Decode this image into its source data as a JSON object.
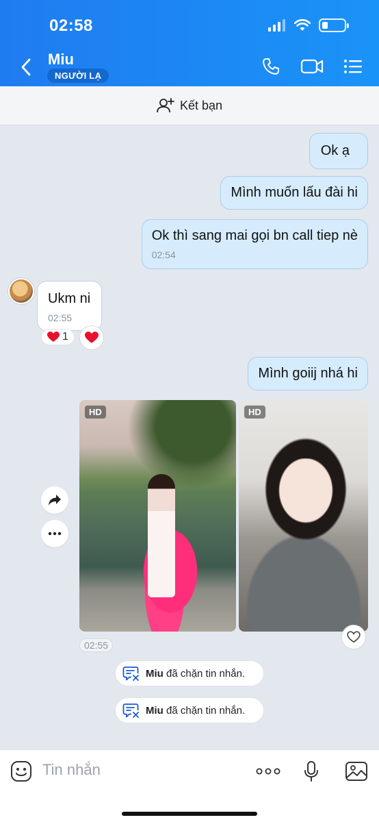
{
  "status_bar": {
    "time": "02:58"
  },
  "header": {
    "contact_name": "Miu",
    "stranger_badge": "NGƯỜI LẠ"
  },
  "add_friend": {
    "label": "Kết bạn"
  },
  "messages": {
    "m1": {
      "text": "Ok ạ"
    },
    "m2": {
      "text": "Mình muốn lấu đài hi"
    },
    "m3": {
      "text": "Ok thì sang mai gọi bn call tiep nè",
      "time": "02:54"
    },
    "m4": {
      "text": "Ukm ni",
      "time": "02:55",
      "reaction_count": "1"
    },
    "m5": {
      "text": "Mình goiij nhá hi"
    },
    "photos": {
      "hd_label": "HD",
      "time": "02:55"
    }
  },
  "notices": [
    {
      "name": "Miu",
      "text": "đã chặn tin nhắn."
    },
    {
      "name": "Miu",
      "text": "đã chặn tin nhắn."
    }
  ],
  "input": {
    "placeholder": "Tin nhắn"
  },
  "colors": {
    "header_blue": "#1f7cf0",
    "my_bubble": "#d6ecfc",
    "heart_red": "#e8112d"
  }
}
